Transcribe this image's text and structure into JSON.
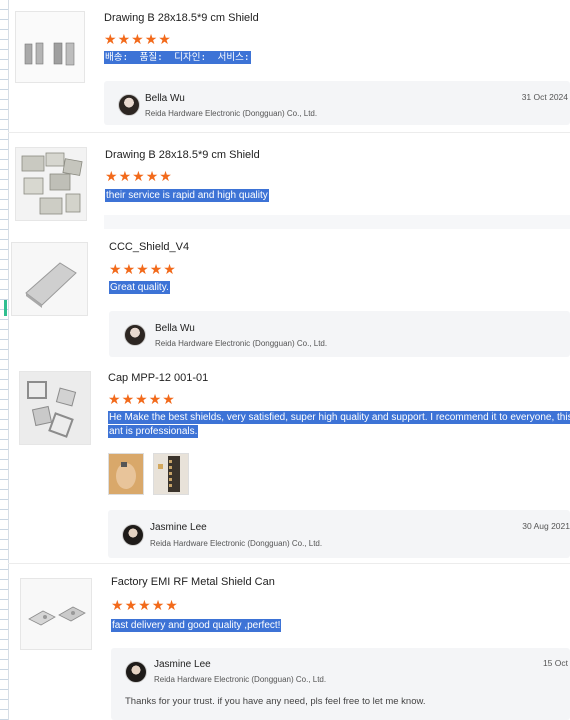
{
  "colors": {
    "star": "#f26a1b",
    "highlight": "#3d73d6",
    "reply_bg": "#f4f5f7"
  },
  "reviews": [
    {
      "product": "Drawing B 28x18.5*9 cm Shield",
      "rating": 5,
      "text": "배송:  품질:  디자인:  서비스:",
      "reply": {
        "name": "Bella Wu",
        "company": "Reida Hardware Electronic (Dongguan) Co., Ltd.",
        "date": "31 Oct 2024"
      }
    },
    {
      "product": "Drawing B 28x18.5*9 cm Shield",
      "rating": 5,
      "text": "their service is rapid and high quality"
    },
    {
      "product": "CCC_Shield_V4",
      "rating": 5,
      "text": "Great quality.",
      "reply": {
        "name": "Bella Wu",
        "company": "Reida Hardware Electronic (Dongguan) Co., Ltd."
      }
    },
    {
      "product": "Cap MPP-12 001-01",
      "rating": 5,
      "text_line1": "He Make the best shields, very satisfied, super high quality and support. I recommend it to everyone, this pl",
      "text_line2": "ant is professionals.",
      "reply": {
        "name": "Jasmine Lee",
        "company": "Reida Hardware Electronic (Dongguan) Co., Ltd.",
        "date": "30 Aug 2021"
      }
    },
    {
      "product": "Factory EMI RF Metal Shield Can",
      "rating": 5,
      "text": "fast delivery and good quality ,perfect!",
      "reply": {
        "name": "Jasmine Lee",
        "company": "Reida Hardware Electronic (Dongguan) Co., Ltd.",
        "date": "15 Oct",
        "message": "Thanks for your trust. if you have any need, pls feel free to let me know."
      }
    }
  ]
}
